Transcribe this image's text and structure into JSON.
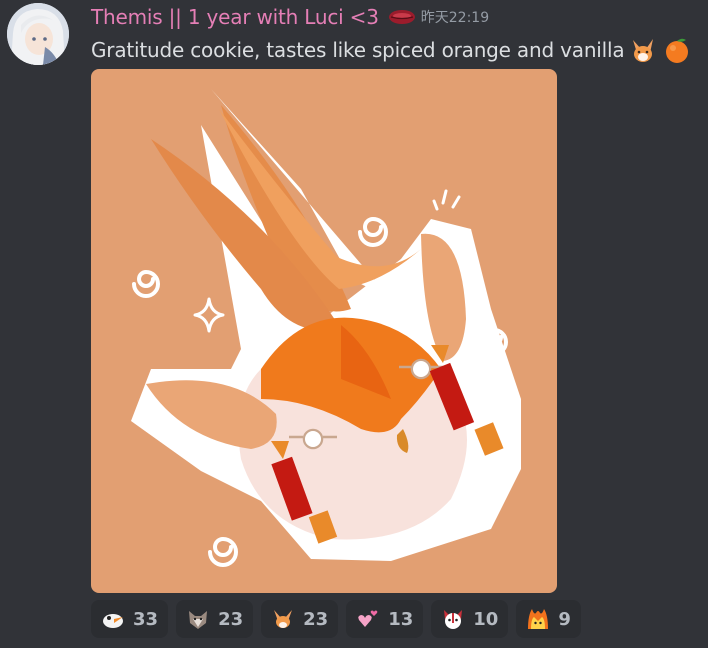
{
  "message": {
    "author": "Themis || 1 year with Luci <3",
    "timestamp": "昨天22:19",
    "text": "Gratitude cookie, tastes like spiced orange and vanilla",
    "inline_emojis": [
      "fox-emoji",
      "orange-emoji"
    ],
    "author_color": "#e57fb6"
  },
  "attachment": {
    "type": "image",
    "subject": "fox-cookie-illustration"
  },
  "reactions": [
    {
      "icon": "goose-emoji",
      "count": "33"
    },
    {
      "icon": "wolf-emoji",
      "count": "23"
    },
    {
      "icon": "fox-emoji",
      "count": "23"
    },
    {
      "icon": "pink-hearts-emoji",
      "count": "13"
    },
    {
      "icon": "dog-face-emoji",
      "count": "10"
    },
    {
      "icon": "fire-cat-emoji",
      "count": "9"
    }
  ]
}
